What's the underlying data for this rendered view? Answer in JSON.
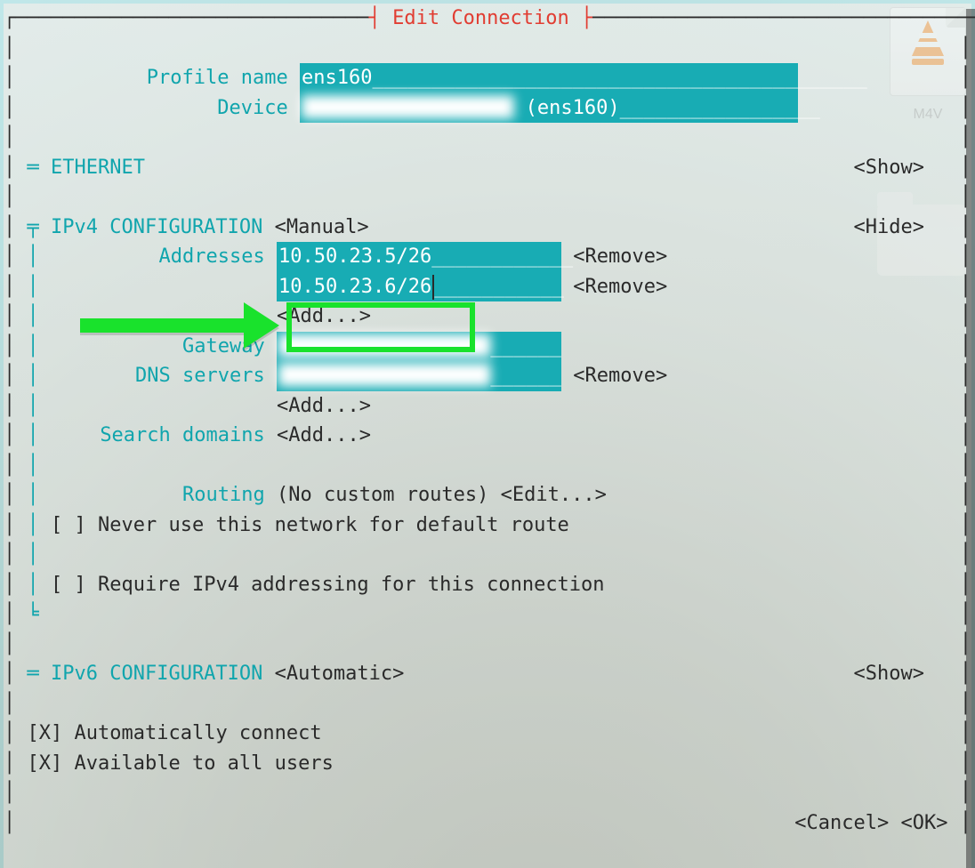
{
  "desktop": {
    "file_type_label": "M4V"
  },
  "dialog": {
    "title_ornament_left": "┤ ",
    "title": "Edit Connection",
    "title_ornament_right": " ├",
    "profile_name_label": "Profile name",
    "profile_name_value": "ens160",
    "device_label": "Device",
    "device_value_redacted": "██████████████████",
    "device_suffix": "(ens160)",
    "ethernet": {
      "collapse_glyph": "═",
      "label": "ETHERNET",
      "action": "<Show>"
    },
    "ipv4": {
      "collapse_glyph": "╤",
      "section_corner": "╘",
      "label": "IPv4 CONFIGURATION",
      "mode": "<Manual>",
      "action": "<Hide>",
      "addresses_label": "Addresses",
      "addresses": [
        {
          "value": "10.50.23.5/26",
          "action": "<Remove>"
        },
        {
          "value": "10.50.23.6/26",
          "action": "<Remove>"
        }
      ],
      "addresses_add": "<Add...>",
      "gateway_label": "Gateway",
      "gateway_value_redacted": "██████████████████",
      "dns_label": "DNS servers",
      "dns_value_redacted": "██████████████████",
      "dns_remove": "<Remove>",
      "dns_add": "<Add...>",
      "search_label": "Search domains",
      "search_add": "<Add...>",
      "routing_label": "Routing",
      "routing_value": "(No custom routes)",
      "routing_edit": "<Edit...>",
      "never_default_label": "Never use this network for default route",
      "never_default_checked": false,
      "require_ipv4_label": "Require IPv4 addressing for this connection",
      "require_ipv4_checked": false
    },
    "ipv6": {
      "collapse_glyph": "═",
      "label": "IPv6 CONFIGURATION",
      "mode": "<Automatic>",
      "action": "<Show>"
    },
    "auto_connect_label": "Automatically connect",
    "auto_connect_checked": true,
    "available_all_label": "Available to all users",
    "available_all_checked": true,
    "cancel": "<Cancel>",
    "ok": "<OK>"
  },
  "glyphs": {
    "checkbox_on": "[X]",
    "checkbox_off": "[ ]",
    "border_tl": "┌",
    "border_h": "─",
    "border_v": "│",
    "field_fill": "_"
  }
}
